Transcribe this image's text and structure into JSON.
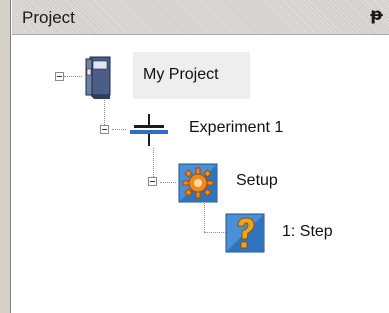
{
  "panel": {
    "title": "Project",
    "pin_glyph": "♒"
  },
  "tree": {
    "project_label": "My Project",
    "experiment_label": "Experiment 1",
    "setup_label": "Setup",
    "step_label": "1: Step"
  },
  "icons": {
    "project": "project-binder-icon",
    "experiment": "experiment-icon",
    "setup": "setup-gear-icon",
    "step": "step-question-icon"
  },
  "colors": {
    "header_bg": "#d6d3ce",
    "selection_bg": "#eeeeee",
    "accent_blue": "#2e6fc2",
    "gear_orange": "#f08a1c"
  }
}
